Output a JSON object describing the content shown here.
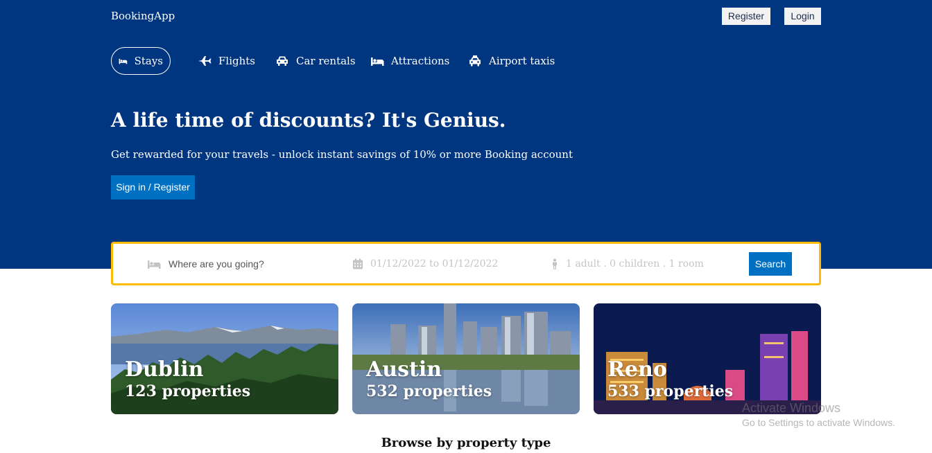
{
  "header": {
    "logo": "BookingApp",
    "register_label": "Register",
    "login_label": "Login"
  },
  "nav": {
    "items": [
      {
        "label": "Stays",
        "icon": "bed-icon"
      },
      {
        "label": "Flights",
        "icon": "plane-icon"
      },
      {
        "label": "Car rentals",
        "icon": "car-icon"
      },
      {
        "label": "Attractions",
        "icon": "bed-icon"
      },
      {
        "label": "Airport taxis",
        "icon": "taxi-icon"
      }
    ]
  },
  "hero": {
    "title": "A life time of discounts? It's Genius.",
    "subtitle": "Get rewarded for your travels - unlock instant savings of 10% or more Booking account",
    "cta_label": "Sign in / Register"
  },
  "search": {
    "destination_placeholder": "Where are you going?",
    "date_range": "01/12/2022 to 01/12/2022",
    "guests": "1 adult . 0 children . 1 room",
    "button_label": "Search"
  },
  "featured": [
    {
      "name": "Dublin",
      "count": "123 properties"
    },
    {
      "name": "Austin",
      "count": "532 properties"
    },
    {
      "name": "Reno",
      "count": "533 properties"
    }
  ],
  "browse": {
    "title": "Browse by property type"
  },
  "watermark": {
    "line1": "Activate Windows",
    "line2": "Go to Settings to activate Windows."
  },
  "colors": {
    "primary": "#003580",
    "button": "#0071c2",
    "search_border": "#febb02"
  }
}
